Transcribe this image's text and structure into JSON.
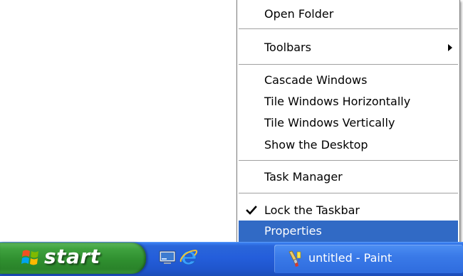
{
  "context_menu": {
    "open_folder": "Open Folder",
    "toolbars": "Toolbars",
    "cascade_windows": "Cascade Windows",
    "tile_horizontally": "Tile Windows Horizontally",
    "tile_vertically": "Tile Windows Vertically",
    "show_desktop": "Show the Desktop",
    "task_manager": "Task Manager",
    "lock_taskbar": "Lock the Taskbar",
    "lock_taskbar_checked": true,
    "properties": "Properties",
    "highlighted_item": "Properties"
  },
  "taskbar": {
    "start_label": "start",
    "quick_launch": [
      {
        "icon": "show-desktop-icon"
      },
      {
        "icon": "internet-explorer-icon"
      }
    ],
    "task_buttons": [
      {
        "label": "untitled - Paint",
        "icon": "paint-icon"
      }
    ]
  },
  "colors": {
    "taskbar_blue": "#245edb",
    "start_green": "#3c9a3c",
    "menu_highlight": "#316ac5"
  }
}
